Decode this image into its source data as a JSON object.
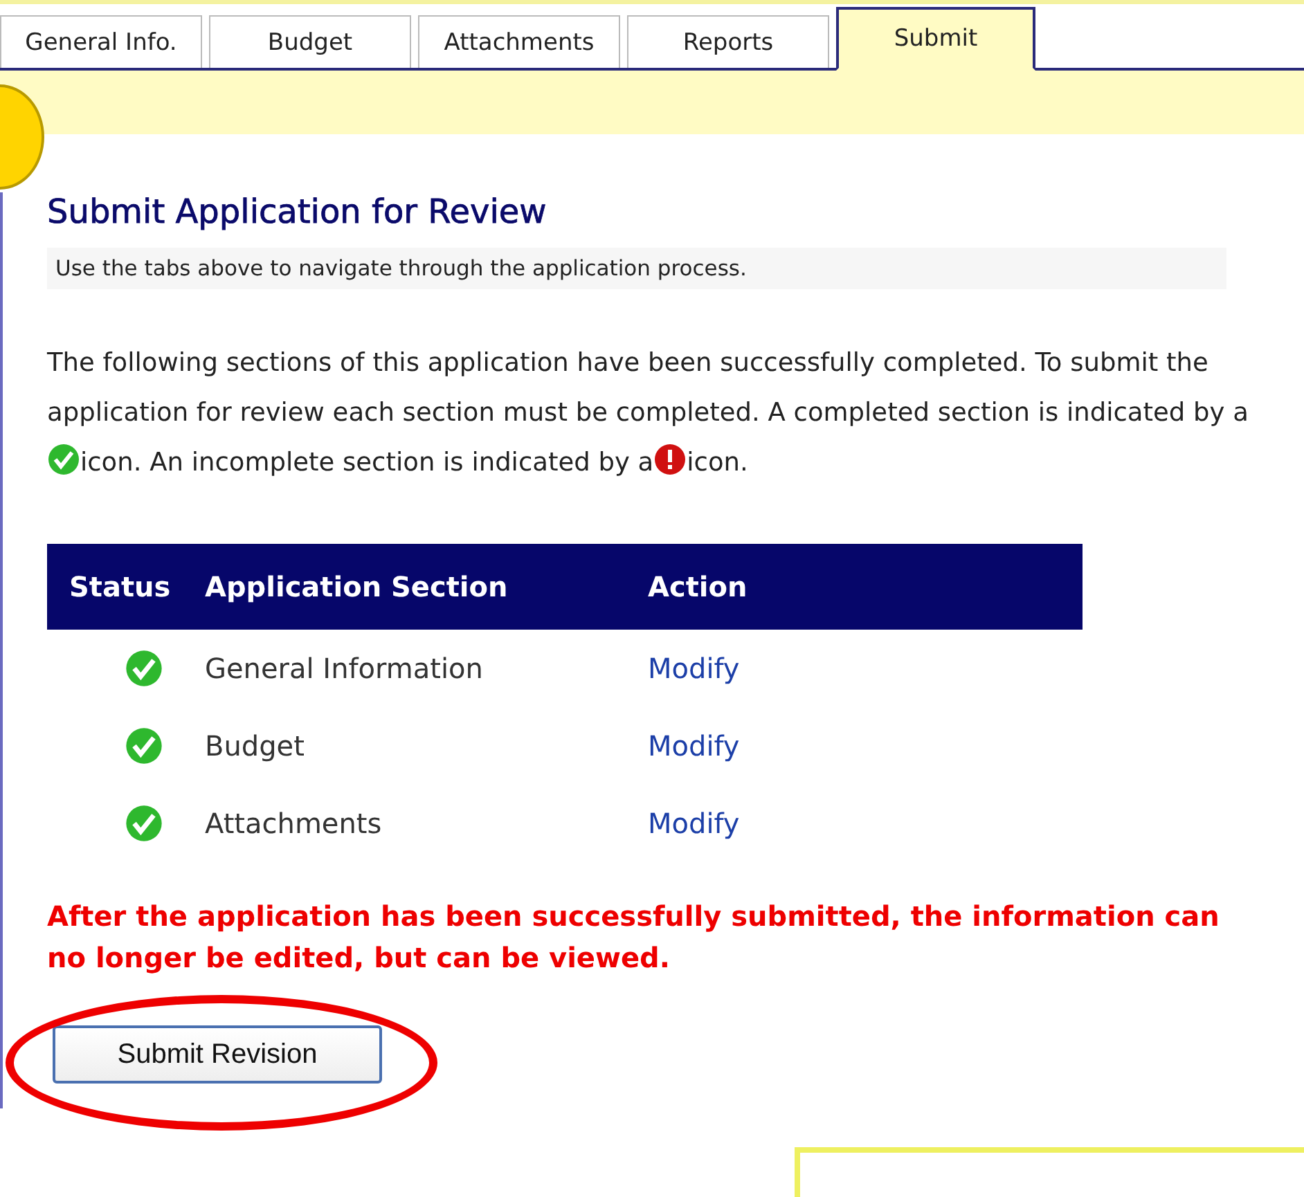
{
  "tabs": [
    {
      "label": "General Info.",
      "selected": false
    },
    {
      "label": "Budget",
      "selected": false
    },
    {
      "label": "Attachments",
      "selected": false
    },
    {
      "label": "Reports",
      "selected": false
    },
    {
      "label": "Submit",
      "selected": true
    }
  ],
  "title": "Submit Application for Review",
  "hint": "Use the tabs above to navigate through the application process.",
  "intro": {
    "before_complete_icon": "The following sections of this application have been successfully completed. To submit the application for review each section must be completed. A completed section is indicated by a",
    "between_icons": "icon. An incomplete section is indicated by a",
    "after_incomplete_icon": "icon."
  },
  "table": {
    "columns": [
      "Status",
      "Application Section",
      "Action"
    ],
    "rows": [
      {
        "completed": true,
        "section": "General Information",
        "action": "Modify"
      },
      {
        "completed": true,
        "section": "Budget",
        "action": "Modify"
      },
      {
        "completed": true,
        "section": "Attachments",
        "action": "Modify"
      }
    ]
  },
  "warning": "After the application has been successfully submitted, the information can no longer be edited, but can be viewed.",
  "submit_button": "Submit Revision"
}
